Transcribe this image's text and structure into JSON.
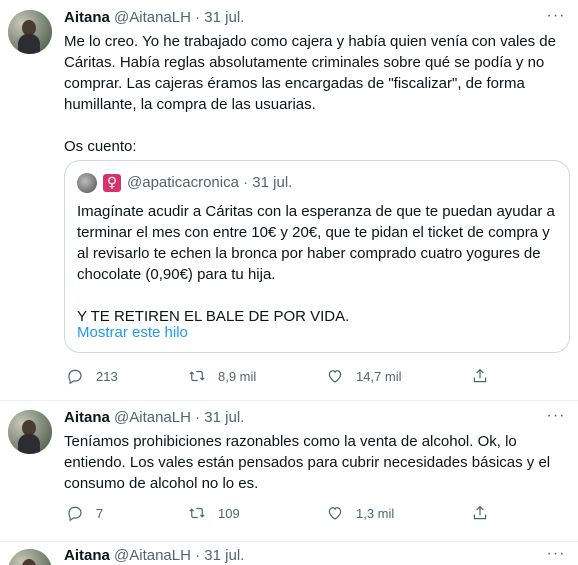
{
  "tweets": [
    {
      "name": "Aitana",
      "handle": "@AitanaLH",
      "separator": "·",
      "date": "31 jul.",
      "text": "Me lo creo. Yo he trabajado como cajera y había quien venía con vales de Cáritas. Había reglas absolutamente criminales sobre qué se podía y no comprar. Las cajeras éramos las encargadas de \"fiscalizar\", de forma humillante, la compra de las usuarias.\n\nOs cuento:",
      "quote": {
        "badge": "♀",
        "handle": "@apaticacronica",
        "separator": "·",
        "date": "31 jul.",
        "text": "Imagínate acudir a Cáritas con la esperanza de que te puedan ayudar a terminar el mes con entre 10€ y 20€, que te pidan el ticket de compra y al revisarlo te echen la bronca por haber comprado cuatro yogures de chocolate (0,90€) para tu hija.\n\nY TE RETIREN EL BALE DE POR VIDA.",
        "show_thread": "Mostrar este hilo"
      },
      "replies": "213",
      "retweets": "8,9 mil",
      "likes": "14,7 mil"
    },
    {
      "name": "Aitana",
      "handle": "@AitanaLH",
      "separator": "·",
      "date": "31 jul.",
      "text": "Teníamos prohibiciones razonables como la venta de alcohol. Ok, lo entiendo. Los vales están pensados para cubrir necesidades básicas y el consumo de alcohol no lo es.",
      "replies": "7",
      "retweets": "109",
      "likes": "1,3 mil"
    },
    {
      "name": "Aitana",
      "handle": "@AitanaLH",
      "separator": "·",
      "date": "31 jul."
    }
  ],
  "more_icon": "···",
  "icons": [
    "reply-icon",
    "retweet-icon",
    "like-icon",
    "share-icon",
    "more-icon"
  ]
}
